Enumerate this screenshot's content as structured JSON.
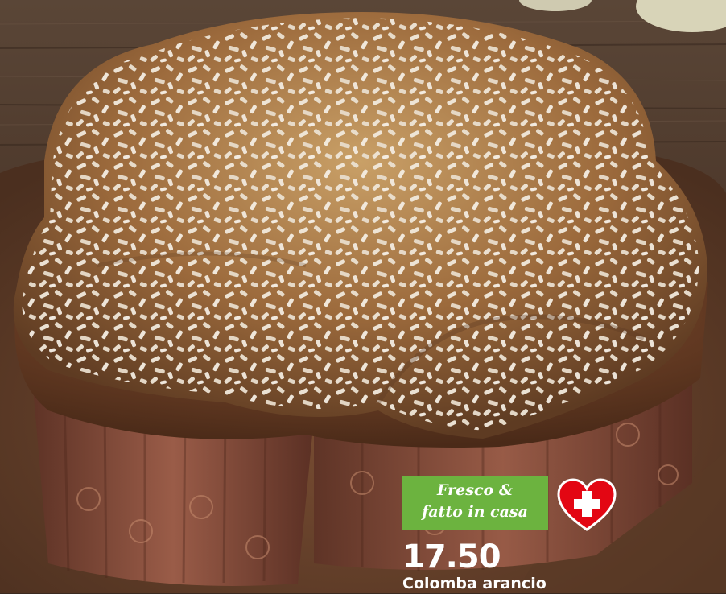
{
  "badge": {
    "line1": "Fresco &",
    "line2": "fatto in casa",
    "color": "#6cb33f"
  },
  "swiss_icon": "swiss-cross-heart-icon",
  "price": "17.50",
  "product_name": "Colomba arancio",
  "colors": {
    "badge_green": "#6cb33f",
    "heart_red": "#e30613",
    "text": "#ffffff"
  }
}
